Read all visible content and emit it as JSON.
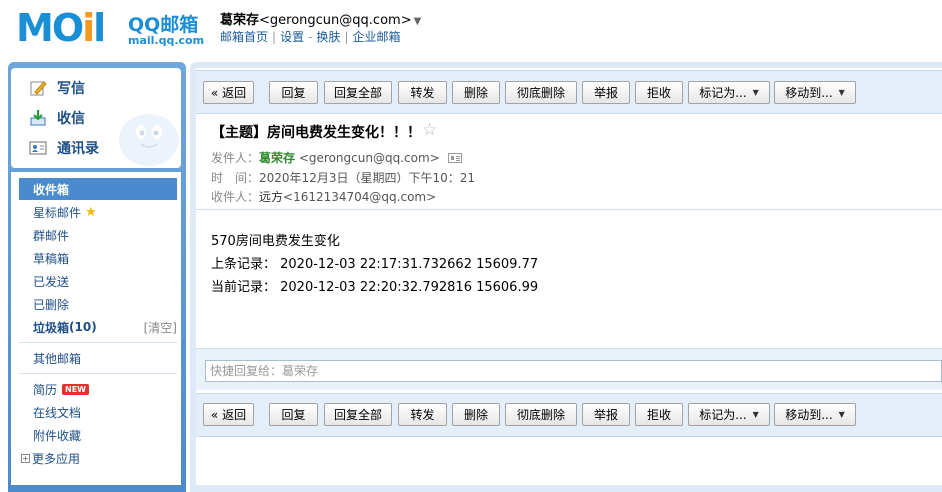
{
  "header": {
    "logo_word": "MOil",
    "brand": "QQ邮箱",
    "domain": "mail.qq.com",
    "user_name": "葛荣存",
    "user_email": "<gerongcun@qq.com>",
    "links": [
      "邮箱首页",
      "设置",
      "换肤",
      "企业邮箱"
    ]
  },
  "quick_actions": [
    {
      "label": "写信",
      "icon": "pencil-icon"
    },
    {
      "label": "收信",
      "icon": "inbox-download-icon"
    },
    {
      "label": "通讯录",
      "icon": "contacts-card-icon"
    }
  ],
  "folders": {
    "inbox": "收件箱",
    "starred": "星标邮件",
    "group": "群邮件",
    "drafts": "草稿箱",
    "sent": "已发送",
    "deleted": "已删除",
    "spam": "垃圾箱",
    "spam_count": "(10)",
    "spam_clear": "[清空]",
    "other": "其他邮箱",
    "resume": "简历",
    "resume_badge": "NEW",
    "docs": "在线文档",
    "attachments": "附件收藏",
    "more_apps": "更多应用",
    "expand_symbol": "+"
  },
  "toolbar": {
    "back": "« 返回",
    "reply": "回复",
    "reply_all": "回复全部",
    "forward": "转发",
    "delete": "删除",
    "delete_forever": "彻底删除",
    "report": "举报",
    "reject": "拒收",
    "mark_as": "标记为...",
    "move_to": "移动到...",
    "dropdown_glyph": "▼"
  },
  "message": {
    "subject": "【主题】房间电费发生变化！！！",
    "star_glyph": "☆",
    "from_label": "发件人：",
    "from_name": "葛荣存",
    "from_email": "<gerongcun@qq.com>",
    "time_label": "时　间：",
    "time_value": "2020年12月3日（星期四）下午10：21",
    "to_label": "收件人：",
    "to_name": "远方",
    "to_email": "<1612134704@qq.com>",
    "body": [
      "570房间电费发生变化",
      "上条记录：  2020-12-03 22:17:31.732662 15609.77",
      "当前记录：  2020-12-03 22:20:32.792816 15606.99"
    ]
  },
  "quick_reply": {
    "placeholder": "快捷回复给：葛荣存"
  },
  "colors": {
    "brand_blue": "#1a8fd6",
    "logo_orange": "#f39a1e",
    "frame_blue": "#4b8ccd",
    "active_folder": "#4a8bd0",
    "sender_green": "#2e8b2e"
  }
}
